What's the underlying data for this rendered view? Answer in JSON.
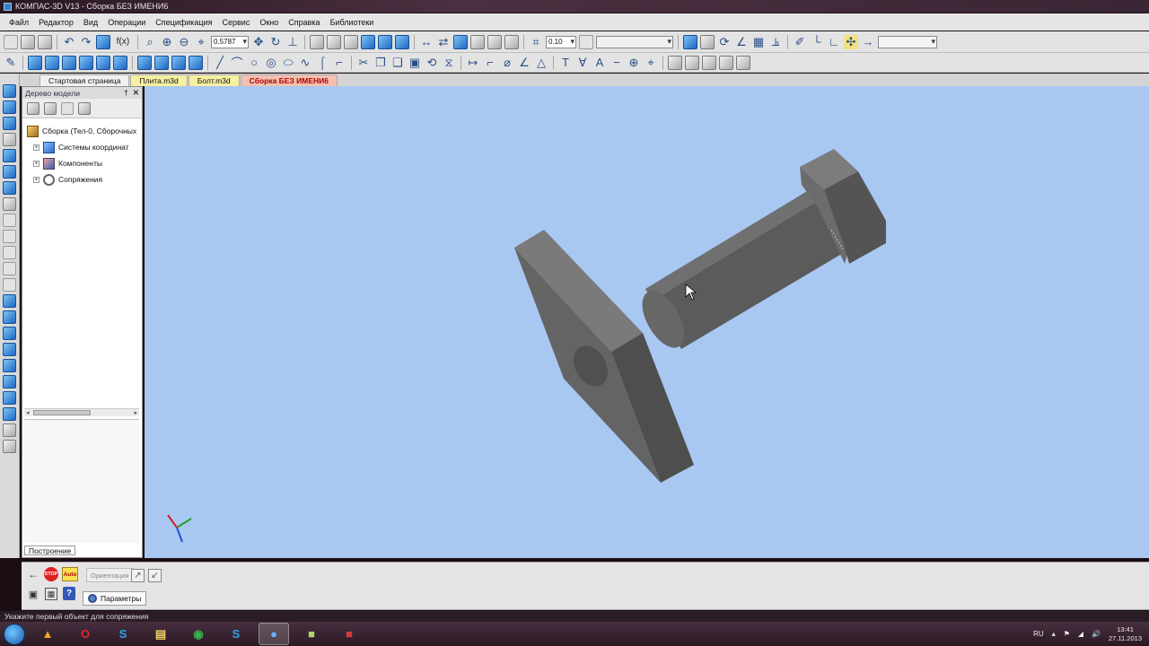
{
  "window": {
    "title": "КОМПАС-3D V13 - Сборка БЕЗ ИМЕНИ6"
  },
  "menu": {
    "items": [
      "Файл",
      "Редактор",
      "Вид",
      "Операции",
      "Спецификация",
      "Сервис",
      "Окно",
      "Справка",
      "Библиотеки"
    ]
  },
  "toolbar": {
    "zoom_value": "0.5787",
    "step_value": "0.10",
    "fx_label": "f(x)"
  },
  "tabs": [
    {
      "label": "Стартовая страница"
    },
    {
      "label": "Плита.m3d"
    },
    {
      "label": "Болт.m3d"
    },
    {
      "label": "Сборка БЕЗ ИМЕНИ6",
      "active": true
    }
  ],
  "tree": {
    "header": "Дерево модели",
    "root_label": "Сборка (Тел-0, Сборочных",
    "items": [
      {
        "label": "Системы координат",
        "icon": "coordinate-system-icon"
      },
      {
        "label": "Компоненты",
        "icon": "components-icon"
      },
      {
        "label": "Сопряжения",
        "icon": "mates-icon"
      }
    ],
    "build_tab": "Построение"
  },
  "propbar": {
    "stop_label": "STOP",
    "auto_label": "Auto",
    "orientation_label": "Ориентация",
    "params_tab": "Параметры"
  },
  "status": {
    "text": "Укажите первый объект для сопряжения"
  },
  "taskbar": {
    "lang": "RU",
    "time": "13:41",
    "date": "27.11.2013"
  },
  "colors": {
    "viewport_bg": "#a8c8f2",
    "part_face": "#5f5f5f",
    "active_tab": "#b00000"
  }
}
